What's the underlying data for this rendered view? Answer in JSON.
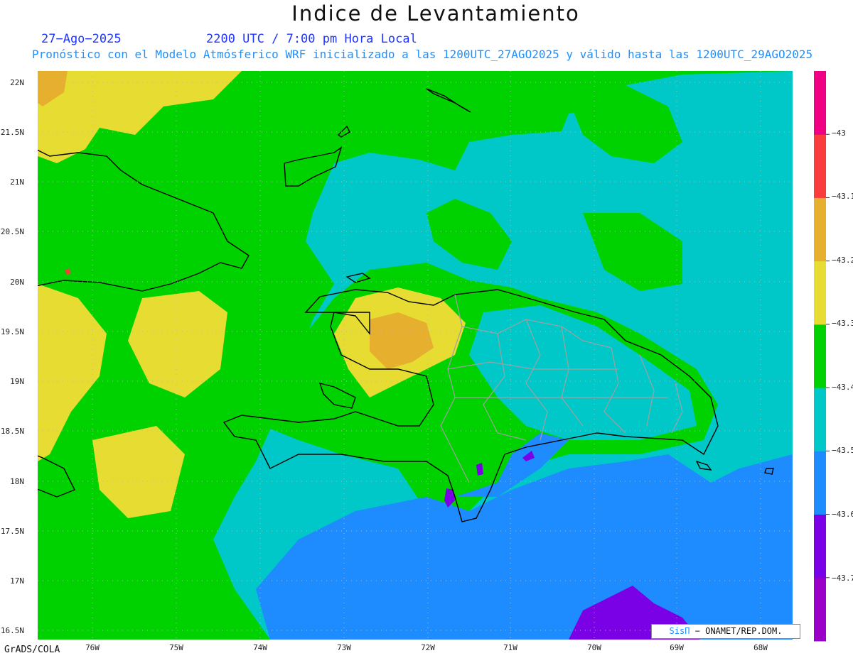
{
  "header": {
    "title": "Indice de Levantamiento",
    "date": "27−Ago−2025",
    "time": "2200 UTC / 7:00 pm Hora Local",
    "subtitle": "Pronóstico con el Modelo Atmósferico WRF inicializado a las 1200UTC_27AGO2025 y válido hasta las  1200UTC_29AGO2025"
  },
  "axes": {
    "lat_labels": [
      "22N",
      "21.5N",
      "21N",
      "20.5N",
      "20N",
      "19.5N",
      "19N",
      "18.5N",
      "18N",
      "17.5N",
      "17N",
      "16.5N"
    ],
    "lon_labels": [
      "76W",
      "75W",
      "74W",
      "73W",
      "72W",
      "71W",
      "70W",
      "69W",
      "68W"
    ]
  },
  "colorbar": {
    "labels": [
      "−43",
      "−43.1",
      "−43.2",
      "−43.3",
      "−43.4",
      "−43.5",
      "−43.6",
      "−43.7"
    ],
    "colors": [
      "#9b00c8",
      "#7a00e6",
      "#1e8cff",
      "#00c8c8",
      "#00d200",
      "#e6dc32",
      "#e6af2d",
      "#fa3c3c",
      "#f00082"
    ]
  },
  "credit": {
    "brand": "SisΠ",
    "text": " − ONAMET/REP.DOM."
  },
  "footer": {
    "software": "GrADS/COLA"
  },
  "map_colors": {
    "yellow": "#e6dc32",
    "orange": "#e6af2d",
    "green": "#00d200",
    "cyan": "#00c8c8",
    "blue": "#1e8cff",
    "purple": "#7a00e6",
    "red": "#fa3c3c",
    "coast": "#000000",
    "provinces": "#a0a0a0"
  }
}
